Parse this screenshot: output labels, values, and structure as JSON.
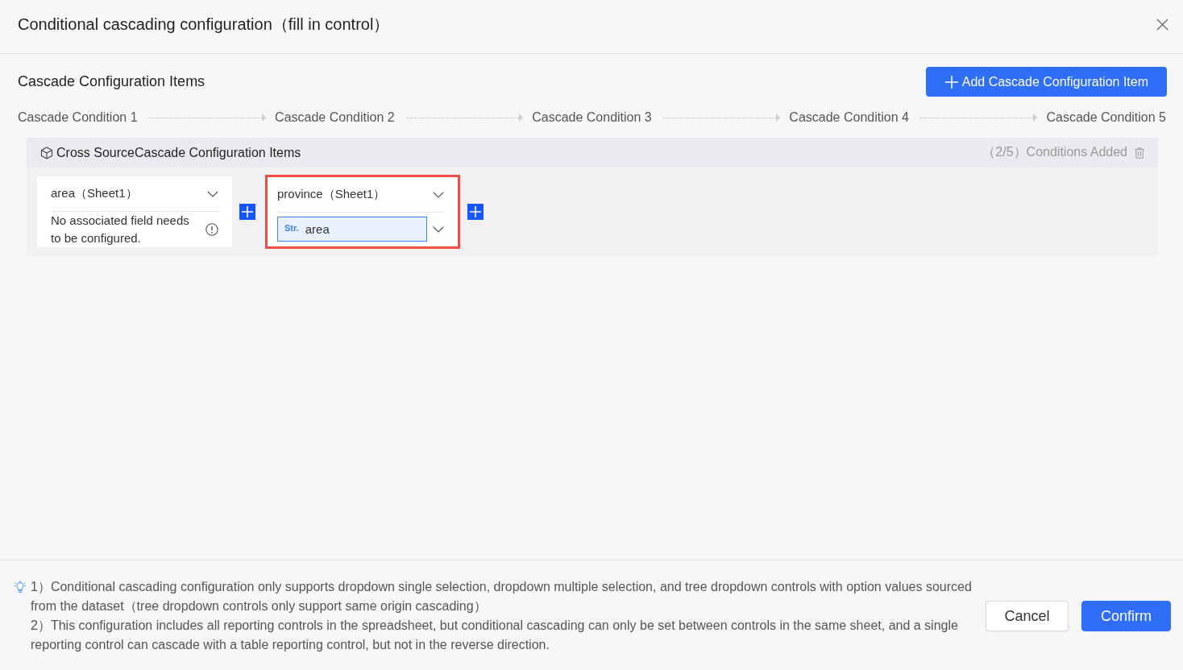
{
  "dialog": {
    "title": "Conditional cascading configuration（fill in control）"
  },
  "section": {
    "title": "Cascade Configuration Items",
    "add_button": "Add Cascade Configuration Item"
  },
  "steps": [
    "Cascade Condition 1",
    "Cascade Condition 2",
    "Cascade Condition 3",
    "Cascade Condition 4",
    "Cascade Condition 5"
  ],
  "group": {
    "title": "Cross SourceCascade Configuration Items",
    "count": "（2/5）Conditions Added",
    "conditions": [
      {
        "control": "area（Sheet1）",
        "kind": "note",
        "note": "No associated field needs to be configured.",
        "highlighted": false
      },
      {
        "control": "province（Sheet1）",
        "kind": "field",
        "field_type": "Str.",
        "field": "area",
        "highlighted": true
      }
    ]
  },
  "tips": [
    "1）Conditional cascading configuration only supports dropdown single selection, dropdown multiple selection, and tree dropdown controls with option values sourced from the dataset（tree dropdown controls only support same origin cascading）",
    "2）This configuration includes all reporting controls in the spreadsheet, but conditional cascading can only be set between controls in the same sheet, and a single reporting control can cascade with a table reporting control, but not in the reverse direction."
  ],
  "buttons": [
    {
      "label": "Cancel",
      "kind": "secondary"
    },
    {
      "label": "Confirm",
      "kind": "primary"
    }
  ]
}
